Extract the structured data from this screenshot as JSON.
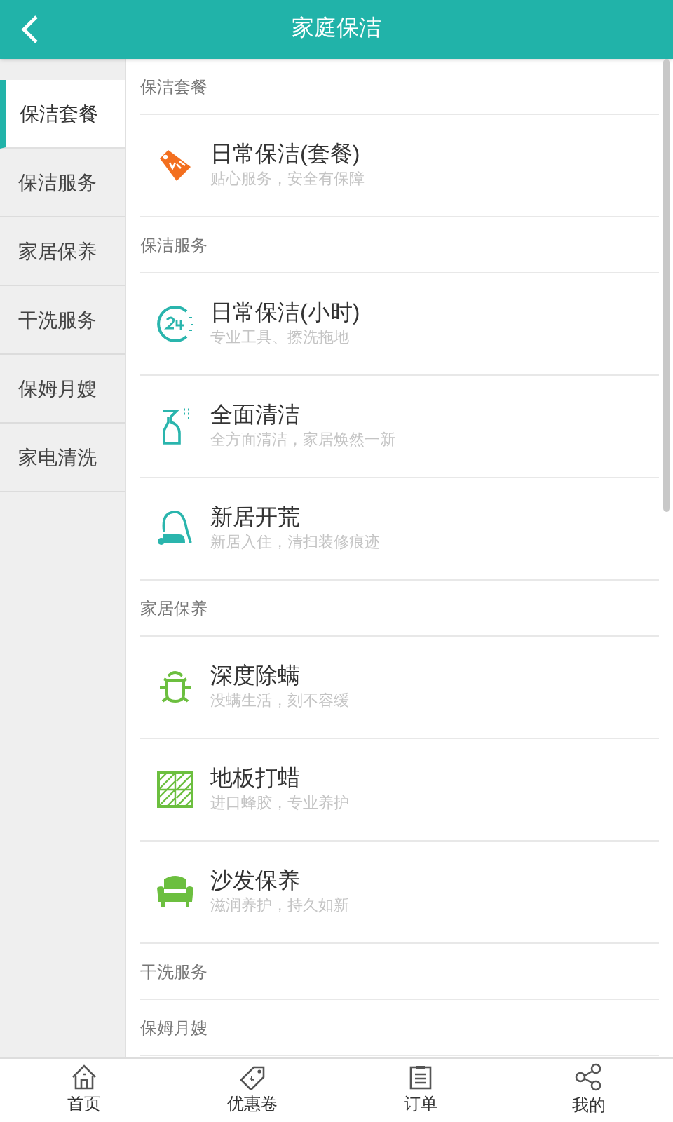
{
  "header": {
    "title": "家庭保洁"
  },
  "sidebar": {
    "items": [
      {
        "label": "保洁套餐",
        "selected": true
      },
      {
        "label": "保洁服务",
        "selected": false
      },
      {
        "label": "家居保养",
        "selected": false
      },
      {
        "label": "干洗服务",
        "selected": false
      },
      {
        "label": "保姆月嫂",
        "selected": false
      },
      {
        "label": "家电清洗",
        "selected": false
      }
    ]
  },
  "sections": [
    {
      "title": "保洁套餐",
      "items": [
        {
          "kind": "vip",
          "name": "日常保洁(套餐)",
          "desc": "贴心服务，安全有保障"
        }
      ]
    },
    {
      "title": "保洁服务",
      "items": [
        {
          "kind": "clock",
          "name": "日常保洁(小时)",
          "desc": "专业工具、擦洗拖地"
        },
        {
          "kind": "spray",
          "name": "全面清洁",
          "desc": "全方面清洁，家居焕然一新"
        },
        {
          "kind": "vacuum",
          "name": "新居开荒",
          "desc": "新居入住，清扫装修痕迹"
        }
      ]
    },
    {
      "title": "家居保养",
      "items": [
        {
          "kind": "bug",
          "name": "深度除螨",
          "desc": "没螨生活，刻不容缓"
        },
        {
          "kind": "floor",
          "name": "地板打蜡",
          "desc": "进口蜂胶，专业养护"
        },
        {
          "kind": "sofa",
          "name": "沙发保养",
          "desc": "滋润养护，持久如新"
        }
      ]
    },
    {
      "title": "干洗服务"
    },
    {
      "title": "保姆月嫂"
    }
  ],
  "tabbar": [
    {
      "kind": "home",
      "label": "首页"
    },
    {
      "kind": "coupon",
      "label": "优惠卷"
    },
    {
      "kind": "order",
      "label": "订单"
    },
    {
      "kind": "share",
      "label": "我的"
    }
  ]
}
